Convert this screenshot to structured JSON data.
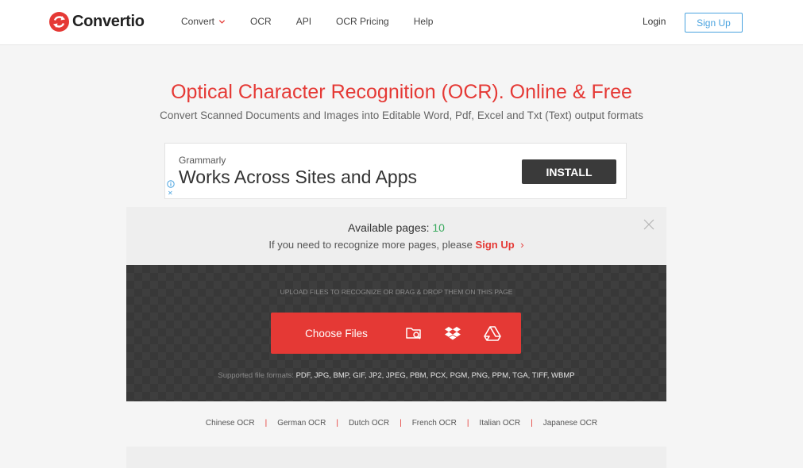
{
  "brand": {
    "name": "Convertio",
    "accent": "#e53935",
    "link_blue": "#4aa3df",
    "green": "#3bab5f"
  },
  "nav": {
    "items": [
      {
        "label": "Convert",
        "has_dropdown": true
      },
      {
        "label": "OCR"
      },
      {
        "label": "API"
      },
      {
        "label": "OCR Pricing"
      },
      {
        "label": "Help"
      }
    ],
    "login": "Login",
    "signup": "Sign Up"
  },
  "hero": {
    "title": "Optical Character Recognition (OCR). Online & Free",
    "subtitle": "Convert Scanned Documents and Images into Editable Word, Pdf, Excel and Txt (Text) output formats"
  },
  "ad": {
    "brand": "Grammarly",
    "headline": "Works Across Sites and Apps",
    "install": "INSTALL",
    "info_icon": "info-icon",
    "close_icon": "ad-close-icon"
  },
  "pages_panel": {
    "available_label": "Available pages:",
    "available_count": "10",
    "more_text": "If you need to recognize more pages, please",
    "signup_link": "Sign Up",
    "chevron": "›"
  },
  "upload": {
    "hint": "UPLOAD FILES TO RECOGNIZE OR DRAG & DROP THEM ON THIS PAGE",
    "choose_label": "Choose Files",
    "sources": [
      "folder-search-icon",
      "dropbox-icon",
      "google-drive-icon"
    ],
    "formats_label": "Supported file formats:",
    "formats_list": "PDF, JPG, BMP, GIF, JP2, JPEG, PBM, PCX, PGM, PNG, PPM, TGA, TIFF, WBMP"
  },
  "languages": [
    "Chinese OCR",
    "German OCR",
    "Dutch OCR",
    "French OCR",
    "Italian OCR",
    "Japanese OCR"
  ]
}
